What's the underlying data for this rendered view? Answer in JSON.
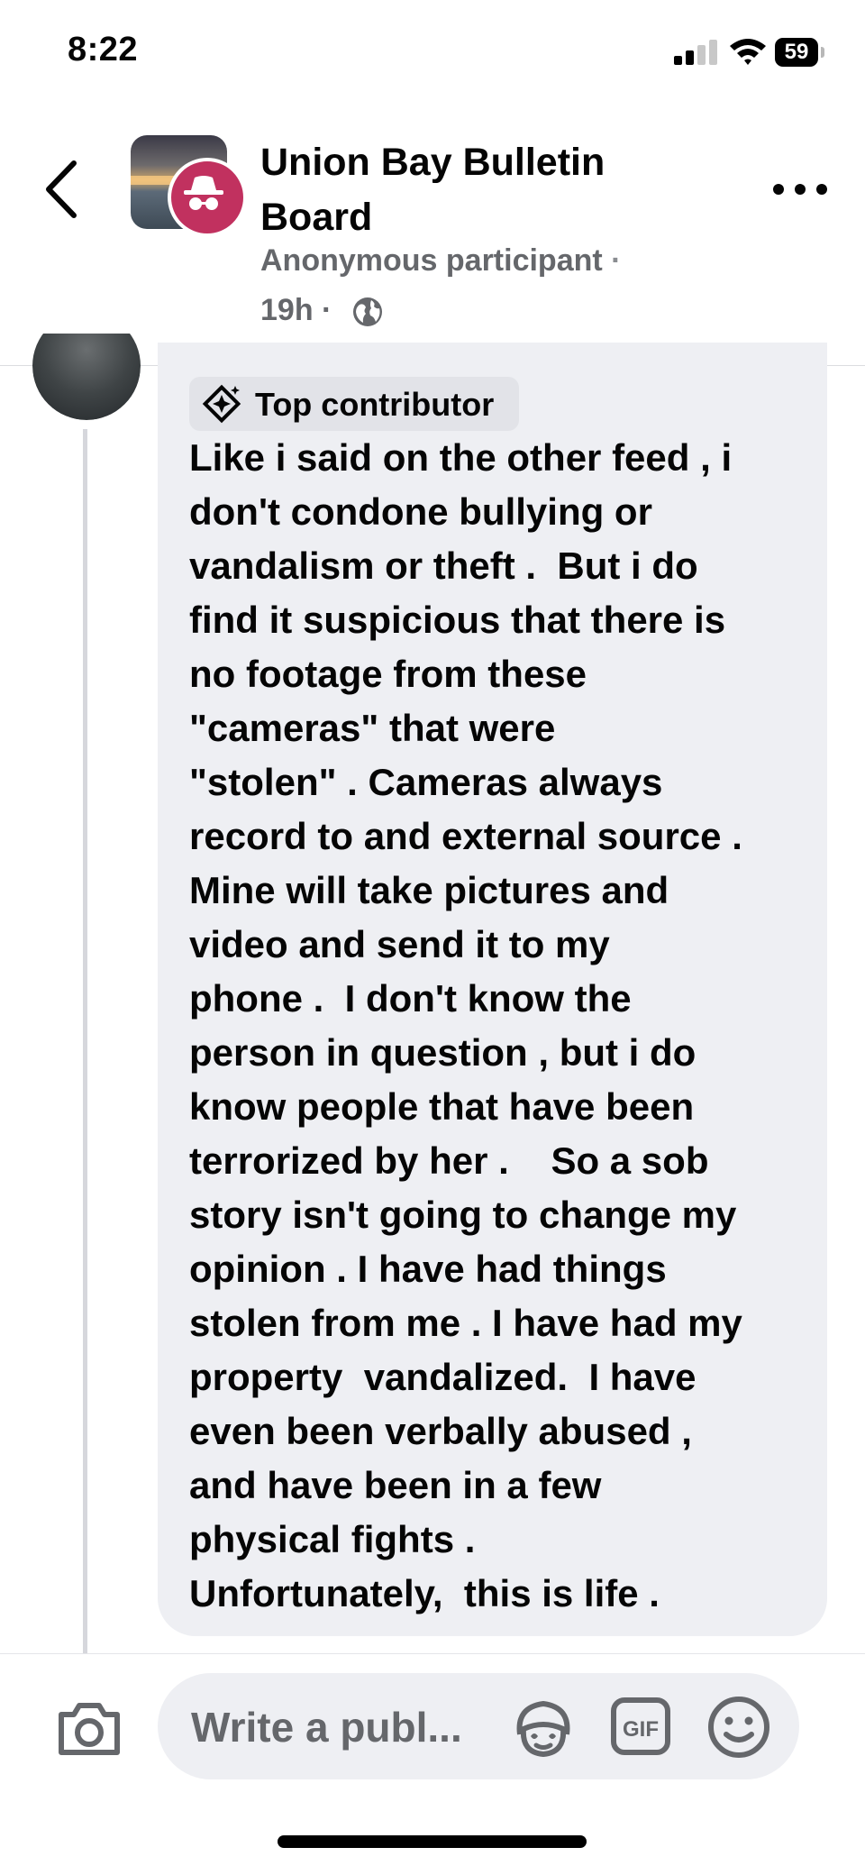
{
  "status_bar": {
    "time": "8:22",
    "battery_level": "59"
  },
  "header": {
    "title": "Union Bay Bulletin Board",
    "author": "Anonymous participant",
    "separator": "·",
    "timestamp": "19h",
    "timestamp_separator": "·",
    "audience_icon": "globe-icon",
    "avatar_badge_icon": "incognito-icon"
  },
  "comment": {
    "badge_label": "Top contributor",
    "badge_icon": "diamond-star-icon",
    "text": "Like i said on the other feed , i\ndon't condone bullying or\nvandalism or theft .  But i do\nfind it suspicious that there is\nno footage from these\n\"cameras\" that were\n\"stolen\" . Cameras always\nrecord to and external source .\nMine will take pictures and\nvideo and send it to my\nphone .  I don't know the\nperson in question , but i do\nknow people that have been\nterrorized by her .    So a sob\nstory isn't going to change my\nopinion . I have had things\nstolen from me . I have had my\nproperty  vandalized.  I have\neven been verbally abused ,\nand have been in a few\nphysical fights .\nUnfortunately,  this is life ."
  },
  "composer": {
    "placeholder": "Write a publ...",
    "camera_icon": "camera-icon",
    "avatar_icon": "avatar-sticker-icon",
    "gif_label": "GIF",
    "emoji_icon": "smiley-icon"
  },
  "colors": {
    "badge_pink": "#c1315f",
    "bubble_bg": "#eeeff3",
    "secondary_text": "#65676b"
  }
}
